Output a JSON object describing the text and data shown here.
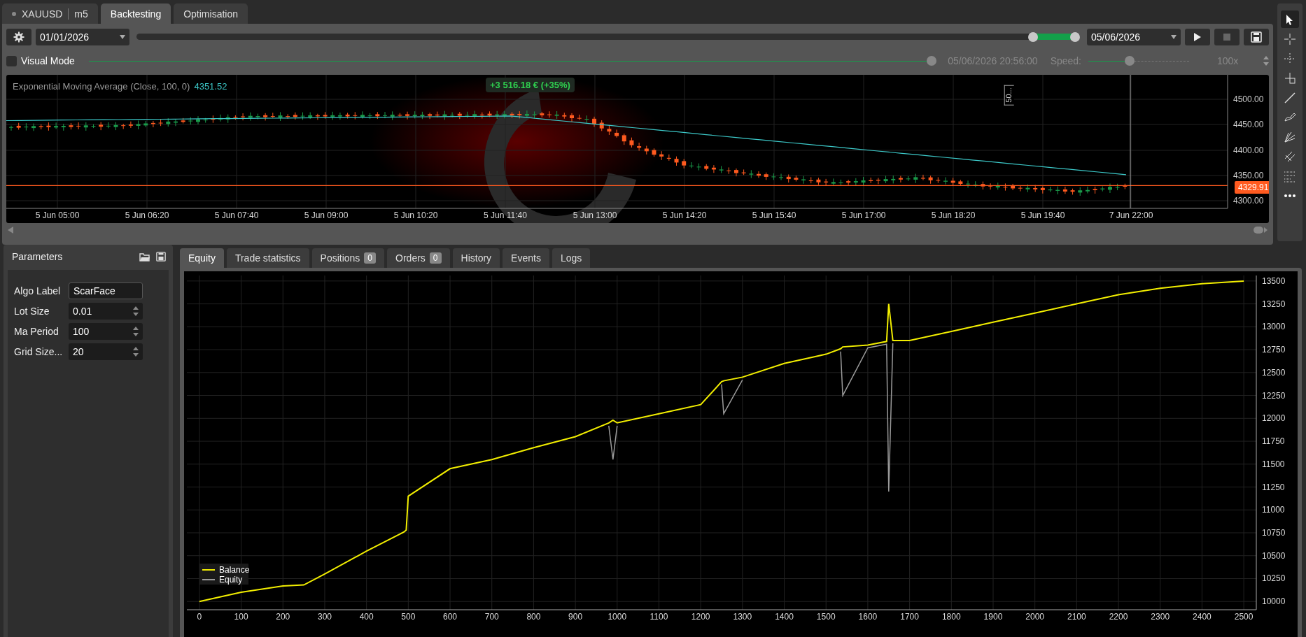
{
  "symbol_tab": {
    "symbol": "XAUUSD",
    "timeframe": "m5"
  },
  "tabs": [
    {
      "label": "Backtesting",
      "selected": true
    },
    {
      "label": "Optimisation",
      "selected": false
    }
  ],
  "controls": {
    "start_date": "01/01/2026",
    "end_date": "05/06/2026",
    "range_thumbs": [
      {
        "level": 0.955
      },
      {
        "level": 1
      }
    ],
    "visual_mode": {
      "label": "Visual Mode",
      "checked": false
    },
    "progress": {
      "level": 1
    },
    "progress_time": "05/06/2026 20:56:00",
    "speed_label": "Speed:",
    "speed": {
      "level": 0.4
    },
    "speed_value": "100x"
  },
  "price_chart": {
    "indicator": "Exponential Moving Average (Close, 100, 0)",
    "indicator_value": "4351.52",
    "profit": "+3 516.18 € (+35%)",
    "bars_label": "50...",
    "y_labels": [
      "4500.00",
      "4450.00",
      "4400.00",
      "4350.00",
      "4300.00"
    ],
    "x_labels": [
      "5 Jun 05:00",
      "5 Jun 06:20",
      "5 Jun 07:40",
      "5 Jun 09:00",
      "5 Jun 10:20",
      "5 Jun 11:40",
      "5 Jun 13:00",
      "5 Jun 14:20",
      "5 Jun 15:40",
      "5 Jun 17:00",
      "5 Jun 18:20",
      "5 Jun 19:40",
      "7 Jun 22:00"
    ],
    "price": "4329.91"
  },
  "toolbar": [
    {
      "kind": "pointer",
      "selected": true
    },
    {
      "kind": "crosshair",
      "selected": false
    },
    {
      "kind": "crosshair-split",
      "selected": false
    },
    {
      "kind": "corner",
      "selected": false
    },
    {
      "kind": "line",
      "selected": false
    },
    {
      "kind": "pen",
      "selected": false
    },
    {
      "kind": "fan",
      "selected": false
    },
    {
      "kind": "parallel",
      "selected": false
    },
    {
      "kind": "levels",
      "selected": false
    },
    {
      "kind": "more",
      "selected": false
    }
  ],
  "parameters": {
    "title": "Parameters",
    "rows": [
      {
        "label": "Algo Label",
        "value": "ScarFace",
        "kind": "text"
      },
      {
        "label": "Lot Size",
        "value": "0.01",
        "kind": "number"
      },
      {
        "label": "Ma Period",
        "value": "100",
        "kind": "number"
      },
      {
        "label": "Grid Size...",
        "value": "20",
        "kind": "number"
      }
    ]
  },
  "result_tabs": [
    {
      "label": "Equity",
      "selected": true
    },
    {
      "label": "Trade statistics",
      "selected": false
    },
    {
      "label": "Positions",
      "badge": "0",
      "selected": false
    },
    {
      "label": "Orders",
      "badge": "0",
      "selected": false
    },
    {
      "label": "History",
      "selected": false
    },
    {
      "label": "Events",
      "selected": false
    },
    {
      "label": "Logs",
      "selected": false
    }
  ],
  "equity_chart": {
    "chart_data": {
      "type": "line",
      "x": [
        0,
        100,
        200,
        250,
        300,
        400,
        490,
        495,
        500,
        600,
        700,
        800,
        900,
        980,
        990,
        1000,
        1100,
        1200,
        1250,
        1255,
        1300,
        1400,
        1500,
        1535,
        1540,
        1600,
        1645,
        1650,
        1660,
        1700,
        1800,
        1900,
        2000,
        2100,
        2200,
        2300,
        2400,
        2500
      ],
      "series": [
        {
          "name": "Balance",
          "color": "#f2ee00",
          "values": [
            10000,
            10100,
            10170,
            10180,
            10300,
            10550,
            10760,
            10780,
            11150,
            11450,
            11550,
            11680,
            11800,
            11950,
            11980,
            11950,
            12050,
            12150,
            12400,
            12410,
            12450,
            12600,
            12700,
            12760,
            12780,
            12800,
            12840,
            13250,
            12850,
            12850,
            12950,
            13050,
            13150,
            13250,
            13350,
            13420,
            13470,
            13500
          ]
        },
        {
          "name": "Equity",
          "color": "#9a9a9a",
          "values": [
            null,
            null,
            null,
            null,
            null,
            null,
            null,
            null,
            null,
            null,
            null,
            null,
            null,
            11920,
            11550,
            11920,
            null,
            null,
            12370,
            12050,
            12420,
            null,
            null,
            12730,
            12250,
            12770,
            12810,
            11200,
            12820,
            null,
            null,
            null,
            null,
            null,
            null,
            null,
            null,
            null
          ]
        }
      ],
      "grid": true,
      "legend": "lower left",
      "xlim": [
        -30,
        2530
      ],
      "ylim": [
        9910,
        13560
      ],
      "xticks": [
        0,
        100,
        200,
        300,
        400,
        500,
        600,
        700,
        800,
        900,
        1000,
        1100,
        1200,
        1300,
        1400,
        1500,
        1600,
        1700,
        1800,
        1900,
        2000,
        2100,
        2200,
        2300,
        2400,
        2500
      ],
      "yticks": [
        10000,
        10250,
        10500,
        10750,
        11000,
        11250,
        11500,
        11750,
        12000,
        12250,
        12500,
        12750,
        13000,
        13250,
        13500
      ]
    }
  }
}
